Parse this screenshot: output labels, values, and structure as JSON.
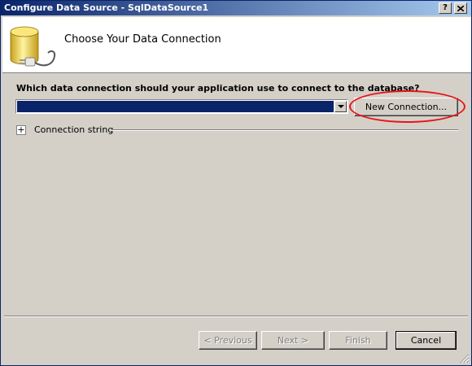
{
  "window": {
    "title": "Configure Data Source - SqlDataSource1",
    "help_label": "?",
    "close_label": "X"
  },
  "header": {
    "title": "Choose Your Data Connection"
  },
  "main": {
    "prompt": "Which data connection should your application use to connect to the database?",
    "connection_combo": {
      "value": ""
    },
    "new_connection_label": "New Connection...",
    "expander_symbol": "+",
    "connection_string_label": "Connection string"
  },
  "footer": {
    "previous_label": "< Previous",
    "next_label": "Next >",
    "finish_label": "Finish",
    "cancel_label": "Cancel"
  },
  "colors": {
    "title_bar": "#0a246a",
    "dialog_bg": "#d4d0c8",
    "selection": "#0a246a",
    "annotation": "#e8141b"
  }
}
